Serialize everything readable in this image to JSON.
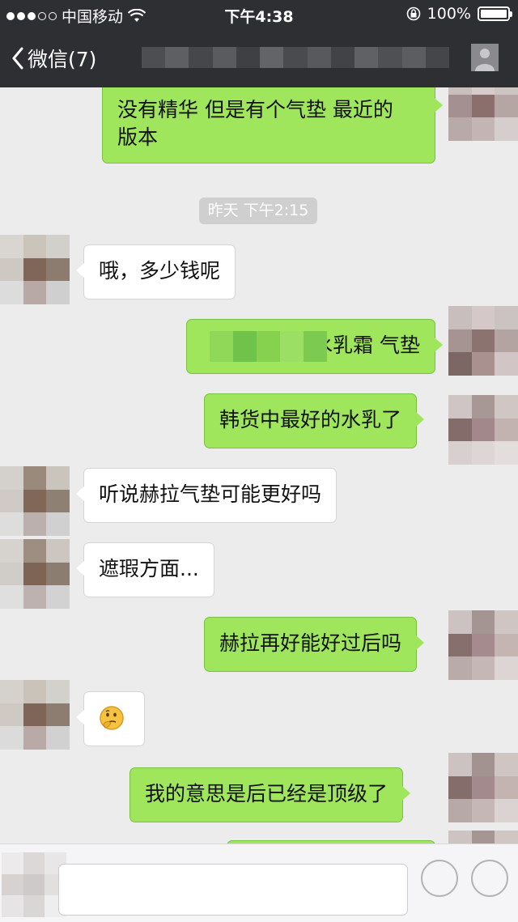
{
  "status_bar": {
    "carrier": "中国移动",
    "time": "下午4:38",
    "battery": "100%",
    "signal_dots": 3,
    "icons": [
      "signal-dots-icon",
      "wifi-icon",
      "rotation-lock-icon",
      "battery-icon"
    ]
  },
  "navbar": {
    "back_label": "微信(7)",
    "icons": [
      "back-chevron-icon",
      "profile-icon"
    ]
  },
  "chat": {
    "timestamp": "昨天 下午2:15",
    "messages": [
      {
        "side": "out",
        "lines": [
          "没有精华 但是有个气垫 最近的",
          "版本"
        ]
      },
      {
        "side": "in",
        "text": "哦，多少钱呢"
      },
      {
        "side": "out",
        "text": "水乳霜 气垫"
      },
      {
        "side": "out",
        "text": "韩货中最好的水乳了"
      },
      {
        "side": "in",
        "text": "听说赫拉气垫可能更好吗"
      },
      {
        "side": "in",
        "text": "遮瑕方面..."
      },
      {
        "side": "out",
        "text": "赫拉再好能好过后吗"
      },
      {
        "side": "in",
        "text": "🤔",
        "icon": "thinking-emoji-icon"
      },
      {
        "side": "out",
        "text": "我的意思是后已经是顶级了"
      },
      {
        "side": "out",
        "text": ""
      }
    ]
  },
  "input_bar": {
    "placeholder": "",
    "icons": [
      "voice-icon",
      "emoji-icon",
      "plus-icon"
    ]
  },
  "colors": {
    "navbar_bg": "#2e2f33",
    "chat_bg": "#ececec",
    "outgoing_bubble": "#9fe65c",
    "incoming_bubble": "#ffffff"
  }
}
